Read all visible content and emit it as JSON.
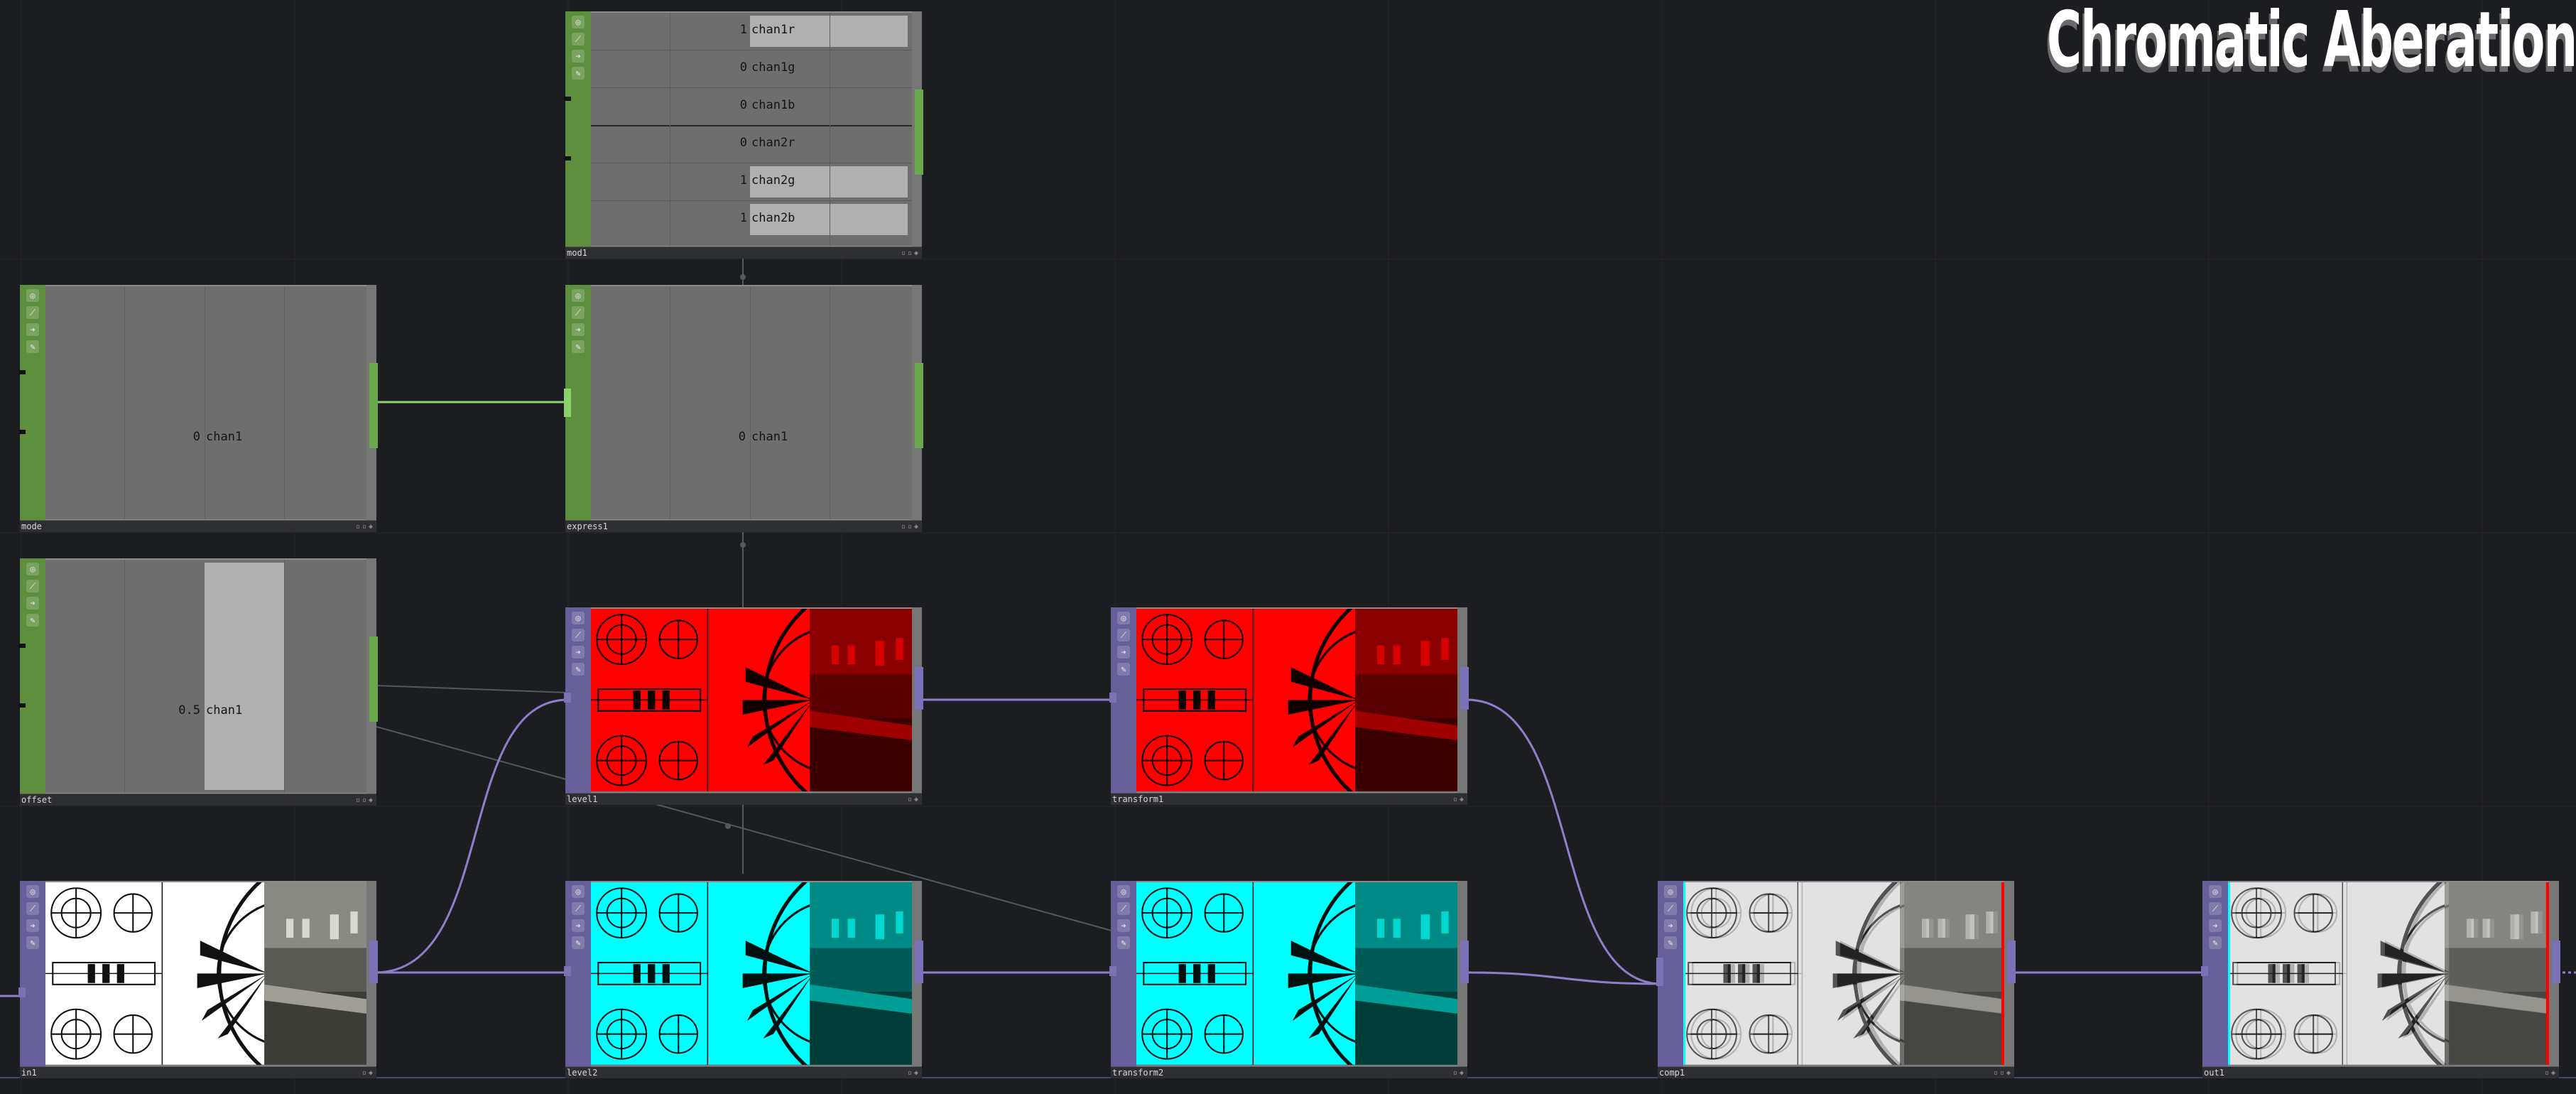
{
  "title": "Chromatic Aberation",
  "colors": {
    "chop": "#5d8f3e",
    "top": "#665f99",
    "wire_top": "#8b80c9",
    "wire_chop": "#8bd26a",
    "background": "#1c1d21"
  },
  "icons": [
    "view-icon",
    "bypass-icon",
    "export-icon",
    "edit-icon"
  ],
  "nodes": {
    "mod1": {
      "label": "mod1",
      "channels": [
        {
          "value": "1",
          "name": "chan1r",
          "level": 1
        },
        {
          "value": "0",
          "name": "chan1g",
          "level": 0
        },
        {
          "value": "0",
          "name": "chan1b",
          "level": 0
        },
        {
          "value": "0",
          "name": "chan2r",
          "level": 0
        },
        {
          "value": "1",
          "name": "chan2g",
          "level": 1
        },
        {
          "value": "1",
          "name": "chan2b",
          "level": 1
        }
      ]
    },
    "mode": {
      "label": "mode",
      "value": "0",
      "channel": "chan1"
    },
    "express1": {
      "label": "express1",
      "value": "0",
      "channel": "chan1"
    },
    "offset": {
      "label": "offset",
      "value": "0.5",
      "channel": "chan1",
      "level": 0.5
    },
    "level1": {
      "label": "level1",
      "tint": "red"
    },
    "transform1": {
      "label": "transform1",
      "tint": "red"
    },
    "in1": {
      "label": "in1",
      "tint": "none"
    },
    "level2": {
      "label": "level2",
      "tint": "cyan"
    },
    "transform2": {
      "label": "transform2",
      "tint": "cyan"
    },
    "comp1": {
      "label": "comp1",
      "tint": "composite"
    },
    "out1": {
      "label": "out1",
      "tint": "composite"
    }
  }
}
